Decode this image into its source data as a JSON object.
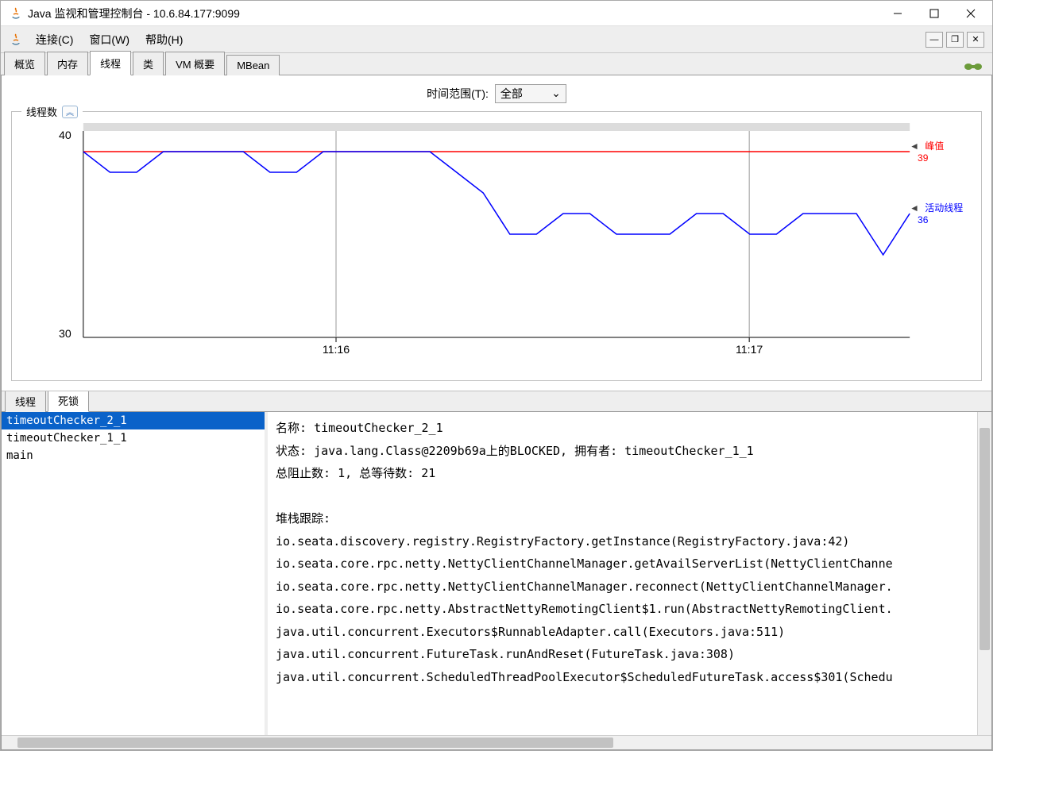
{
  "window": {
    "title": "Java 监视和管理控制台 - 10.6.84.177:9099"
  },
  "menubar": {
    "connect": "连接(C)",
    "window": "窗口(W)",
    "help": "帮助(H)"
  },
  "tabs": {
    "overview": "概览",
    "memory": "内存",
    "threads": "线程",
    "classes": "类",
    "vm": "VM 概要",
    "mbean": "MBean"
  },
  "time_range": {
    "label": "时间范围(T):",
    "value": "全部"
  },
  "chart_data": {
    "type": "line",
    "title": "线程数",
    "ylabel": "",
    "xlabel": "",
    "ylim": [
      30,
      40
    ],
    "y_ticks": [
      30,
      40
    ],
    "x_ticks": [
      "11:16",
      "11:17"
    ],
    "series": [
      {
        "name": "峰值",
        "value_label": "39",
        "color": "#ff0000",
        "values": [
          39,
          39,
          39,
          39,
          39,
          39,
          39,
          39,
          39,
          39,
          39,
          39,
          39,
          39,
          39,
          39,
          39,
          39,
          39,
          39,
          39,
          39,
          39,
          39,
          39,
          39,
          39,
          39,
          39,
          39,
          39,
          39
        ]
      },
      {
        "name": "活动线程",
        "value_label": "36",
        "color": "#0000ff",
        "values": [
          39,
          38,
          38,
          39,
          39,
          39,
          39,
          38,
          38,
          39,
          39,
          39,
          39,
          39,
          38,
          37,
          35,
          35,
          36,
          36,
          35,
          35,
          35,
          36,
          36,
          35,
          35,
          36,
          36,
          36,
          34,
          36
        ]
      }
    ]
  },
  "deadlock_tabs": {
    "threads": "线程",
    "deadlock": "死锁"
  },
  "thread_list": [
    "timeoutChecker_2_1",
    "timeoutChecker_1_1",
    "main"
  ],
  "thread_detail": {
    "name_label": "名称:",
    "name_value": "timeoutChecker_2_1",
    "state_label": "状态:",
    "state_value": "java.lang.Class@2209b69a上的BLOCKED, 拥有者: timeoutChecker_1_1",
    "blocked_label": "总阻止数:",
    "blocked_value": "1,",
    "waited_label": "总等待数:",
    "waited_value": "21",
    "stack_label": "堆栈跟踪:",
    "stack": [
      "io.seata.discovery.registry.RegistryFactory.getInstance(RegistryFactory.java:42)",
      "io.seata.core.rpc.netty.NettyClientChannelManager.getAvailServerList(NettyClientChanne",
      "io.seata.core.rpc.netty.NettyClientChannelManager.reconnect(NettyClientChannelManager.",
      "io.seata.core.rpc.netty.AbstractNettyRemotingClient$1.run(AbstractNettyRemotingClient.",
      "java.util.concurrent.Executors$RunnableAdapter.call(Executors.java:511)",
      "java.util.concurrent.FutureTask.runAndReset(FutureTask.java:308)",
      "java.util.concurrent.ScheduledThreadPoolExecutor$ScheduledFutureTask.access$301(Schedu"
    ]
  }
}
